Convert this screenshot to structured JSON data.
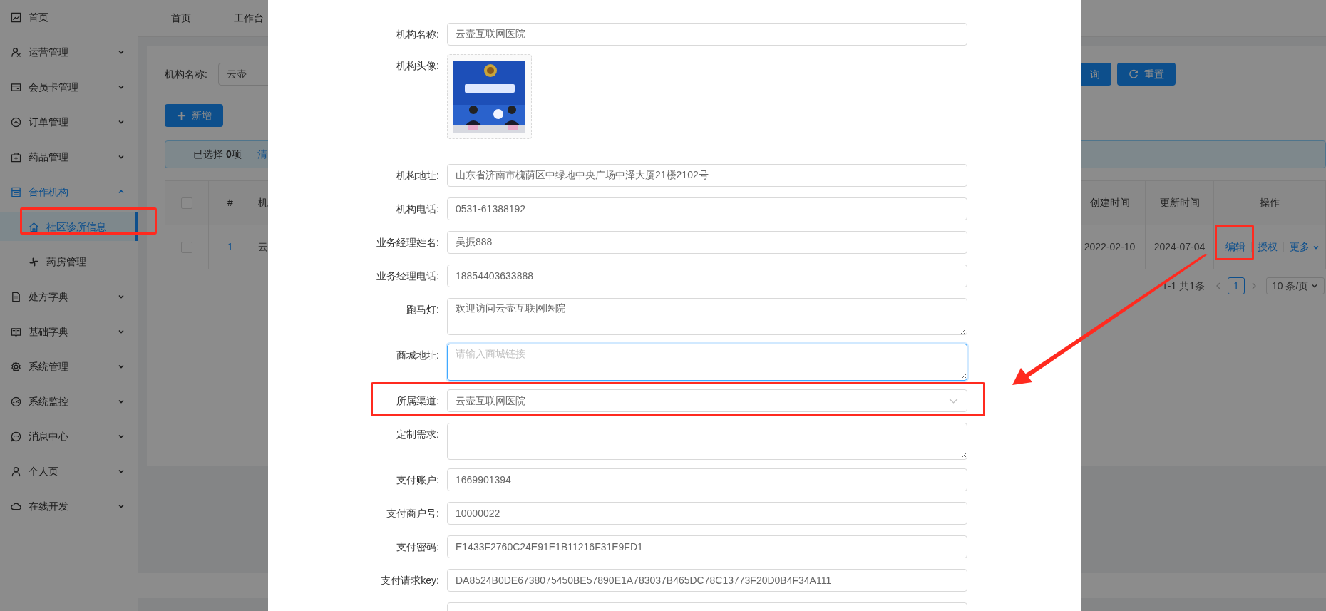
{
  "sidebar": {
    "items": [
      {
        "kind": "link",
        "label": "首页",
        "selected": false
      },
      {
        "kind": "group",
        "label": "运营管理",
        "expanded": false
      },
      {
        "kind": "group",
        "label": "会员卡管理",
        "expanded": false
      },
      {
        "kind": "group",
        "label": "订单管理",
        "expanded": false
      },
      {
        "kind": "group",
        "label": "药品管理",
        "expanded": false
      },
      {
        "kind": "group",
        "label": "合作机构",
        "expanded": true,
        "children": [
          {
            "label": "社区诊所信息",
            "selected": true
          },
          {
            "label": "药房管理",
            "selected": false
          }
        ]
      },
      {
        "kind": "group",
        "label": "处方字典",
        "expanded": false
      },
      {
        "kind": "group",
        "label": "基础字典",
        "expanded": false
      },
      {
        "kind": "group",
        "label": "系统管理",
        "expanded": false
      },
      {
        "kind": "group",
        "label": "系统监控",
        "expanded": false
      },
      {
        "kind": "group",
        "label": "消息中心",
        "expanded": false
      },
      {
        "kind": "group",
        "label": "个人页",
        "expanded": false
      },
      {
        "kind": "group",
        "label": "在线开发",
        "expanded": false
      }
    ]
  },
  "header_tabs": [
    "首页",
    "工作台"
  ],
  "filter": {
    "label": "机构名称:",
    "value": "云壶"
  },
  "filter_buttons": [
    "询",
    "重置"
  ],
  "add_button": "新增",
  "selection_alert": {
    "text": "已选择 **0**项",
    "clear_link": "清"
  },
  "table": {
    "header_checked": false,
    "columns": [
      "#",
      "机",
      "创建时间",
      "更新时间",
      "操作"
    ],
    "rows": [
      {
        "checked": false,
        "cells": [
          "1",
          "云",
          "2022-02-10",
          "2024-07-04"
        ],
        "actions": [
          "编辑",
          "授权",
          "更多"
        ]
      }
    ]
  },
  "pagination": {
    "summary": "1-1 共1条",
    "pages": [
      {
        "label": "1",
        "selected": true
      }
    ],
    "page_size": "10 条/页"
  },
  "modal": {
    "fields": [
      {
        "kind": "input",
        "label": "机构名称:",
        "value": "云壶互联网医院",
        "focused": false
      },
      {
        "label": "机构头像:"
      },
      {
        "kind": "input",
        "label": "机构地址:",
        "value": "山东省济南市槐荫区中绿地中央广场中泽大厦21楼2102号",
        "focused": false
      },
      {
        "kind": "input",
        "label": "机构电话:",
        "value": "0531-61388192",
        "focused": false
      },
      {
        "kind": "input",
        "label": "业务经理姓名:",
        "value": "吴振888",
        "focused": false
      },
      {
        "kind": "input",
        "label": "业务经理电话:",
        "value": "18854403633888",
        "focused": false
      },
      {
        "kind": "textarea",
        "label": "跑马灯:",
        "value": "欢迎访问云壶互联网医院",
        "focused": false
      },
      {
        "kind": "textarea",
        "label": "商城地址:",
        "placeholder": "请输入商城链接",
        "focused": true
      },
      {
        "kind": "select",
        "label": "所属渠道:",
        "value": "云壶互联网医院",
        "focused": false
      },
      {
        "kind": "textarea",
        "label": "定制需求:",
        "focused": false
      },
      {
        "kind": "input",
        "label": "支付账户:",
        "value": "1669901394",
        "focused": false
      },
      {
        "kind": "input",
        "label": "支付商户号:",
        "value": "10000022",
        "focused": false
      },
      {
        "kind": "input",
        "label": "支付密码:",
        "value": "E1433F2760C24E91E1B11216F31E9FD1",
        "focused": false
      },
      {
        "kind": "input",
        "label": "支付请求key:",
        "value": "DA8524B0DE6738075450BE57890E1A783037B465DC78C13773F20D0B4F34A111",
        "focused": false
      },
      {
        "kind": "input",
        "focused": false
      }
    ]
  }
}
